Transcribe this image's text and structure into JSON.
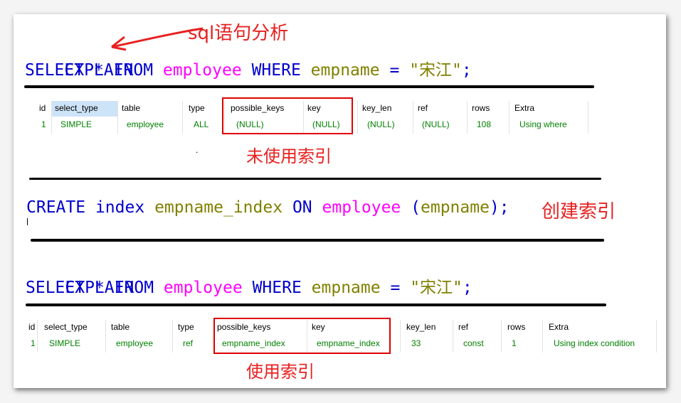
{
  "annotations": {
    "analyze": "sql语句分析",
    "no_index": "未使用索引",
    "create_index": "创建索引",
    "use_index": "使用索引",
    "dot": "."
  },
  "query1": {
    "explain": "EXPLAIN",
    "select": "SELECT",
    "star": "*",
    "from": "FROM",
    "table": "employee",
    "where": "WHERE",
    "column": "empname",
    "eq": "=",
    "value": "\"宋江\"",
    "semi": ";"
  },
  "create": {
    "create": "CREATE",
    "index_kw": "index",
    "index_name": "empname_index",
    "on": "ON",
    "table": "employee",
    "open": "(",
    "column": "empname",
    "close": ");"
  },
  "query2": {
    "explain": "EXPLAIN",
    "select": "SELECT",
    "star": "*",
    "from": "FROM",
    "table": "employee",
    "where": "WHERE",
    "column": "empname",
    "eq": "=",
    "value": "\"宋江\"",
    "semi": ";"
  },
  "result1": {
    "headers": [
      "id",
      "select_type",
      "table",
      "type",
      "possible_keys",
      "key",
      "key_len",
      "ref",
      "rows",
      "Extra"
    ],
    "row": [
      "1",
      "SIMPLE",
      "employee",
      "ALL",
      "(NULL)",
      "(NULL)",
      "(NULL)",
      "(NULL)",
      "108",
      "Using where"
    ]
  },
  "result2": {
    "headers": [
      "id",
      "select_type",
      "table",
      "type",
      "possible_keys",
      "key",
      "key_len",
      "ref",
      "rows",
      "Extra"
    ],
    "row": [
      "1",
      "SIMPLE",
      "employee",
      "ref",
      "empname_index",
      "empname_index",
      "33",
      "const",
      "1",
      "Using index condition"
    ]
  },
  "colors": {
    "keyword": "#0000cc",
    "table": "#ff00ff",
    "identifier": "#808000",
    "annotation": "#e82020",
    "result_value": "#008000",
    "highlight_box": "#e00000"
  }
}
